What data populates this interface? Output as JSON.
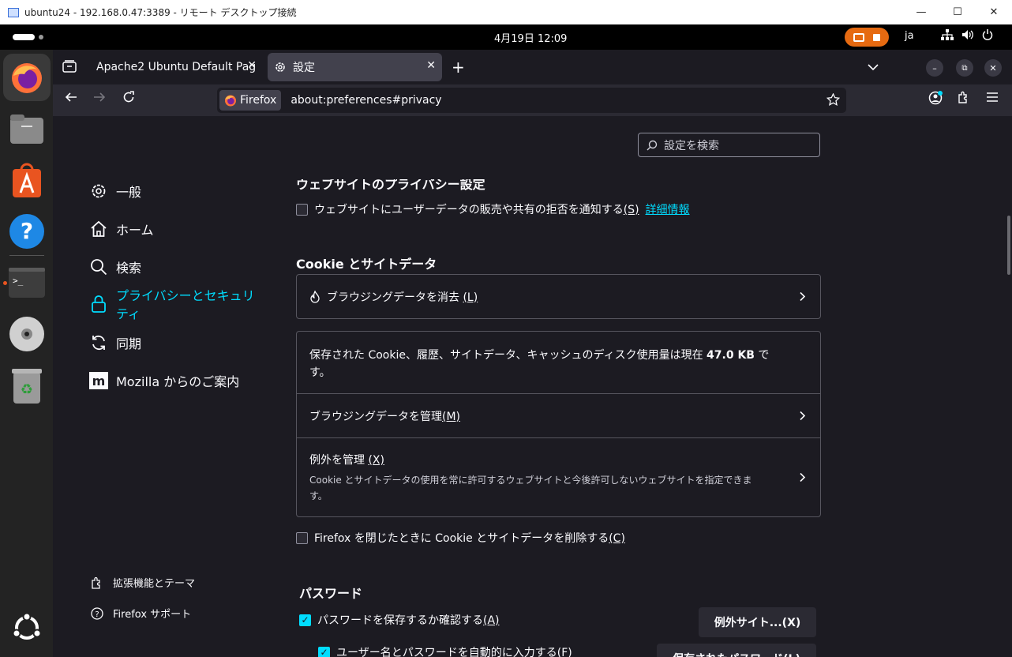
{
  "rdp": {
    "title": "ubuntu24 - 192.168.0.47:3389 - リモート デスクトップ接続",
    "minimize": "—",
    "maximize": "☐",
    "close": "✕"
  },
  "topbar": {
    "clock": "4月19日  12:09",
    "lang": "ja"
  },
  "tabs": [
    {
      "title": "Apache2 Ubuntu Default Pag",
      "close": "✕"
    },
    {
      "title": "設定",
      "close": "✕"
    }
  ],
  "window_controls": {
    "minimize": "–",
    "restore": "⧉",
    "close": "✕"
  },
  "urlbar": {
    "identity": "Firefox",
    "url": "about:preferences#privacy"
  },
  "search": {
    "placeholder": "設定を検索"
  },
  "categories": [
    {
      "label": "一般"
    },
    {
      "label": "ホーム"
    },
    {
      "label": "検索"
    },
    {
      "label": "プライバシーとセキュリティ"
    },
    {
      "label": "同期"
    },
    {
      "label": "Mozilla からのご案内"
    }
  ],
  "footer_links": [
    {
      "label": "拡張機能とテーマ"
    },
    {
      "label": "Firefox サポート"
    }
  ],
  "privacy_section": {
    "heading": "ウェブサイトのプライバシー設定",
    "dnt_checkbox": "ウェブサイトにユーザーデータの販売や共有の拒否を通知する",
    "dnt_key": "(S)",
    "dnt_link": "詳細情報"
  },
  "cookies": {
    "heading": "Cookie とサイトデータ",
    "clear_label": "ブラウジングデータを消去",
    "clear_key": "(L)",
    "usage_text_1": "保存された Cookie、履歴、サイトデータ、キャッシュのディスク使用量は現在",
    "usage_amount": "47.0 KB",
    "usage_text_2": "で",
    "usage_text_3": "す。",
    "manage_label": "ブラウジングデータを管理",
    "manage_key": "(M)",
    "exceptions_label": "例外を管理",
    "exceptions_key": "(X)",
    "exceptions_desc_1": "Cookie とサイトデータの使用を常に許可するウェブサイトと今後許可しないウェブサイトを指定できま",
    "exceptions_desc_2": "す。",
    "delete_on_close": "Firefox を閉じたときに Cookie とサイトデータを削除する",
    "delete_on_close_key": "(C)"
  },
  "passwords": {
    "heading": "パスワード",
    "ask_save": "パスワードを保存するか確認する",
    "ask_save_key": "(A)",
    "exceptions_button": "例外サイト...(X)",
    "autofill": "ユーザー名とパスワードを自動的に入力する",
    "autofill_key": "(F)",
    "saved_button": "保存されたパスワード(L)"
  },
  "colors": {
    "accent": "#00ddff",
    "background": "#1c1b22",
    "ubuntu_orange": "#e95420"
  }
}
